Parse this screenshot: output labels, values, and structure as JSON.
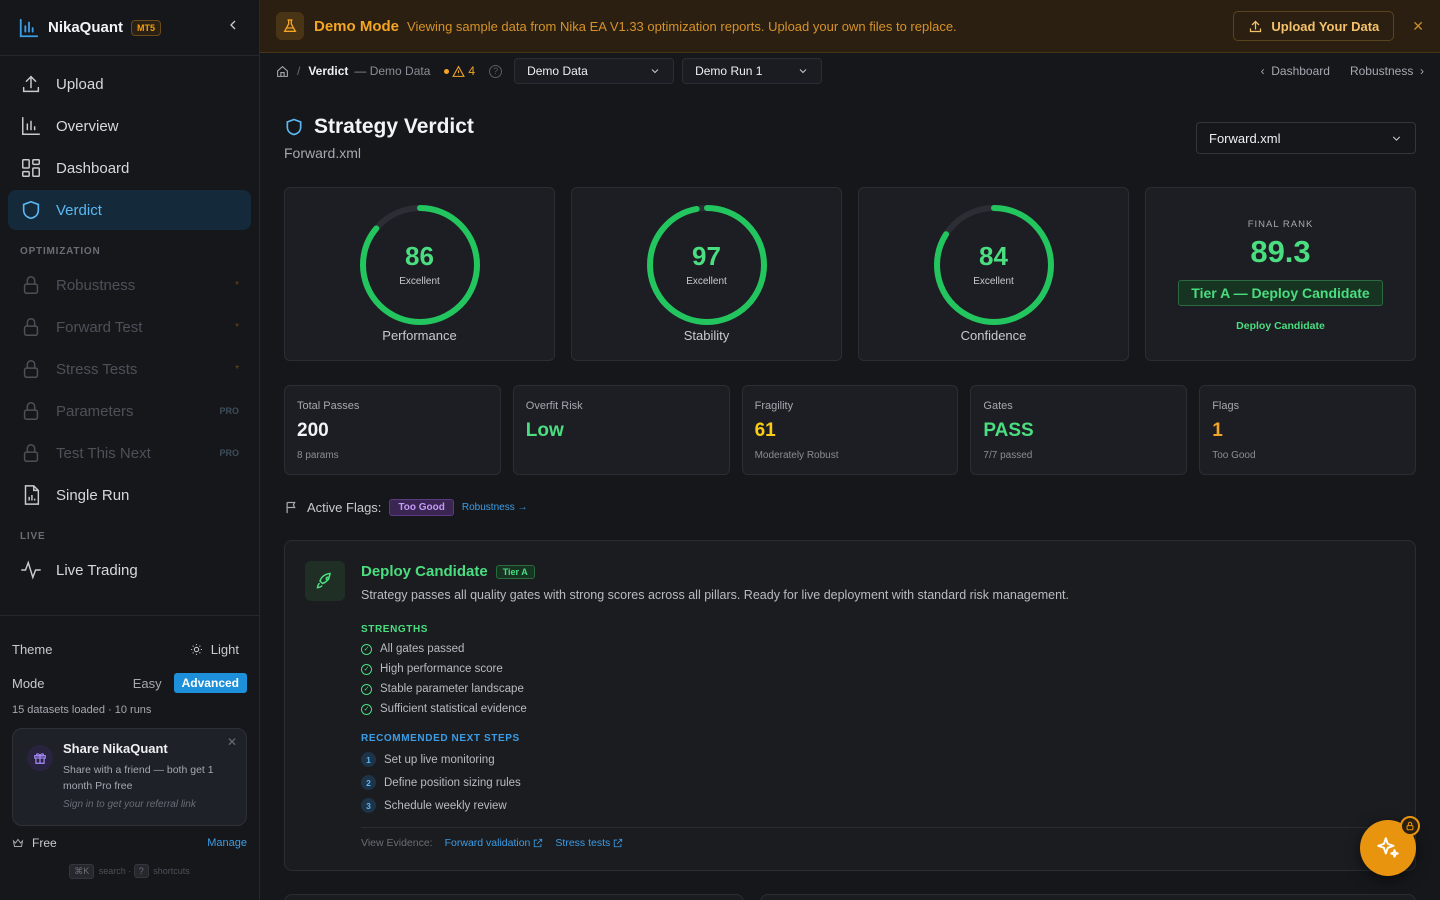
{
  "brand": {
    "name": "NikaQuant",
    "badge": "MT5"
  },
  "nav": {
    "main": [
      {
        "label": "Upload",
        "icon": "upload-icon"
      },
      {
        "label": "Overview",
        "icon": "bar-chart-icon"
      },
      {
        "label": "Dashboard",
        "icon": "dashboard-icon"
      },
      {
        "label": "Verdict",
        "icon": "shield-icon",
        "active": true
      }
    ],
    "optimization_title": "OPTIMIZATION",
    "optimization": [
      {
        "label": "Robustness",
        "marker": "*"
      },
      {
        "label": "Forward Test",
        "marker": "*"
      },
      {
        "label": "Stress Tests",
        "marker": "*"
      },
      {
        "label": "Parameters",
        "tag": "PRO"
      },
      {
        "label": "Test This Next",
        "tag": "PRO"
      }
    ],
    "single_run": "Single Run",
    "live_title": "LIVE",
    "live_trading": "Live Trading"
  },
  "sidebar_bottom": {
    "theme_label": "Theme",
    "theme_toggle": "Light",
    "mode_label": "Mode",
    "mode_easy": "Easy",
    "mode_advanced": "Advanced",
    "datasets": "15 datasets loaded · 10 runs",
    "share_title": "Share NikaQuant",
    "share_desc": "Share with a friend — both get 1 month Pro free",
    "share_link": "Sign in to get your referral link",
    "plan": "Free",
    "manage": "Manage",
    "kbd_search": "⌘K",
    "search_label": "search",
    "kbd_shortcuts": "?",
    "shortcuts_label": "shortcuts"
  },
  "banner": {
    "title": "Demo Mode",
    "text": "Viewing sample data from Nika EA V1.33 optimization reports. Upload your own files to replace.",
    "upload_label": "Upload Your Data"
  },
  "topbar": {
    "crumb_sep": "/",
    "crumb_current": "Verdict",
    "crumb_sub": "— Demo Data",
    "warning_count": "4",
    "dataset_select": "Demo Data",
    "run_select": "Demo Run 1",
    "prev_link": "Dashboard",
    "next_link": "Robustness"
  },
  "page": {
    "title": "Strategy Verdict",
    "subtitle": "Forward.xml",
    "file_select": "Forward.xml"
  },
  "scores": [
    {
      "name": "Performance",
      "value": 86,
      "label": "Excellent"
    },
    {
      "name": "Stability",
      "value": 97,
      "label": "Excellent"
    },
    {
      "name": "Confidence",
      "value": 84,
      "label": "Excellent"
    }
  ],
  "rank": {
    "heading": "FINAL RANK",
    "value": "89.3",
    "tier": "Tier A — Deploy Candidate",
    "footer": "Deploy Candidate"
  },
  "metrics": [
    {
      "label": "Total Passes",
      "value": "200",
      "sub": "8 params",
      "color": "#f2f3f5"
    },
    {
      "label": "Overfit Risk",
      "value": "Low",
      "sub": "",
      "color": "#4ade80"
    },
    {
      "label": "Fragility",
      "value": "61",
      "sub": "Moderately Robust",
      "color": "#facc15"
    },
    {
      "label": "Gates",
      "value": "PASS",
      "sub": "7/7 passed",
      "color": "#4ade80"
    },
    {
      "label": "Flags",
      "value": "1",
      "sub": "Too Good",
      "color": "#f5a524"
    }
  ],
  "flags": {
    "label": "Active Flags:",
    "tag": "Too Good",
    "link": "Robustness →"
  },
  "verdict": {
    "title": "Deploy Candidate",
    "tier": "Tier A",
    "description": "Strategy passes all quality gates with strong scores across all pillars. Ready for live deployment with standard risk management.",
    "strengths_title": "STRENGTHS",
    "strengths": [
      "All gates passed",
      "High performance score",
      "Stable parameter landscape",
      "Sufficient statistical evidence"
    ],
    "steps_title": "RECOMMENDED NEXT STEPS",
    "steps": [
      "Set up live monitoring",
      "Define position sizing rules",
      "Schedule weekly review"
    ],
    "evidence_label": "View Evidence:",
    "evidence_links": [
      "Forward validation",
      "Stress tests"
    ]
  },
  "colors": {
    "accent": "#3b9de6",
    "success": "#4ade80",
    "warning": "#f5a524",
    "fab": "#e8940f"
  }
}
